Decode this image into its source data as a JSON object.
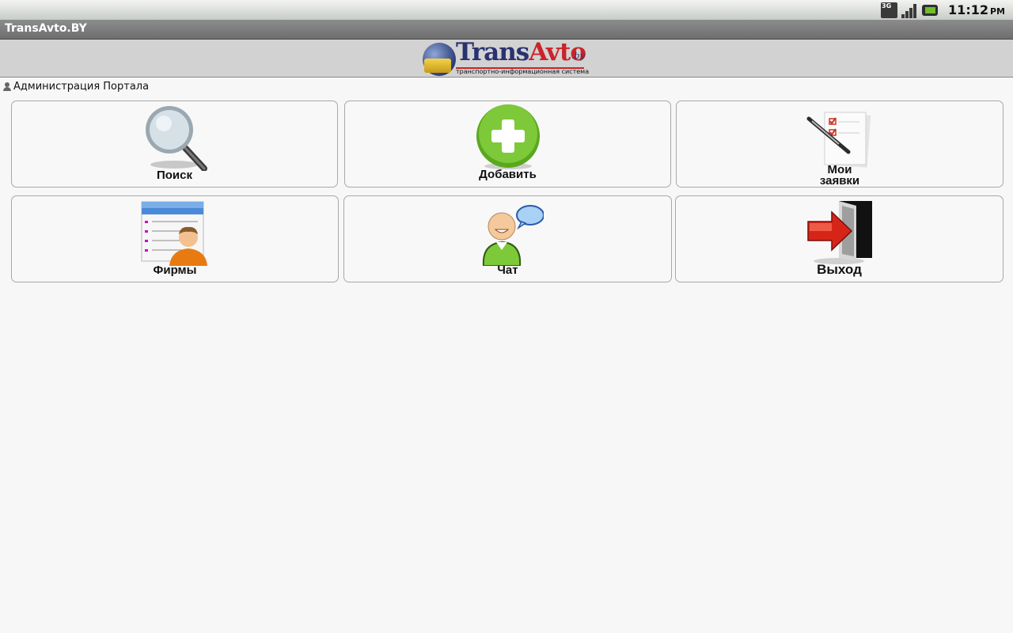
{
  "status_bar": {
    "network": "3G",
    "time": "11:12",
    "ampm": "PM",
    "icons": [
      "3g-icon",
      "signal-icon",
      "battery-icon"
    ]
  },
  "app": {
    "title": "TransAvto.BY"
  },
  "logo": {
    "part1": "Trans",
    "part2": "Avto",
    "suffix": ".by",
    "tagline": "транспортно-информационная система"
  },
  "user": {
    "name": "Администрация Портала"
  },
  "tiles": [
    {
      "label": "Поиск",
      "icon": "search-icon"
    },
    {
      "label": "Добавить",
      "icon": "add-icon"
    },
    {
      "label": "Мои\nзаявки",
      "icon": "my-requests-icon"
    },
    {
      "label": "Фирмы",
      "icon": "firms-icon"
    },
    {
      "label": "Чат",
      "icon": "chat-icon"
    },
    {
      "label": "Выход",
      "icon": "exit-icon"
    }
  ],
  "colors": {
    "title_bar": "#7a7a7a",
    "logo_blue": "#2a3170",
    "logo_red": "#c9242a",
    "add_green": "#6cbf2b",
    "exit_red": "#d62518"
  }
}
